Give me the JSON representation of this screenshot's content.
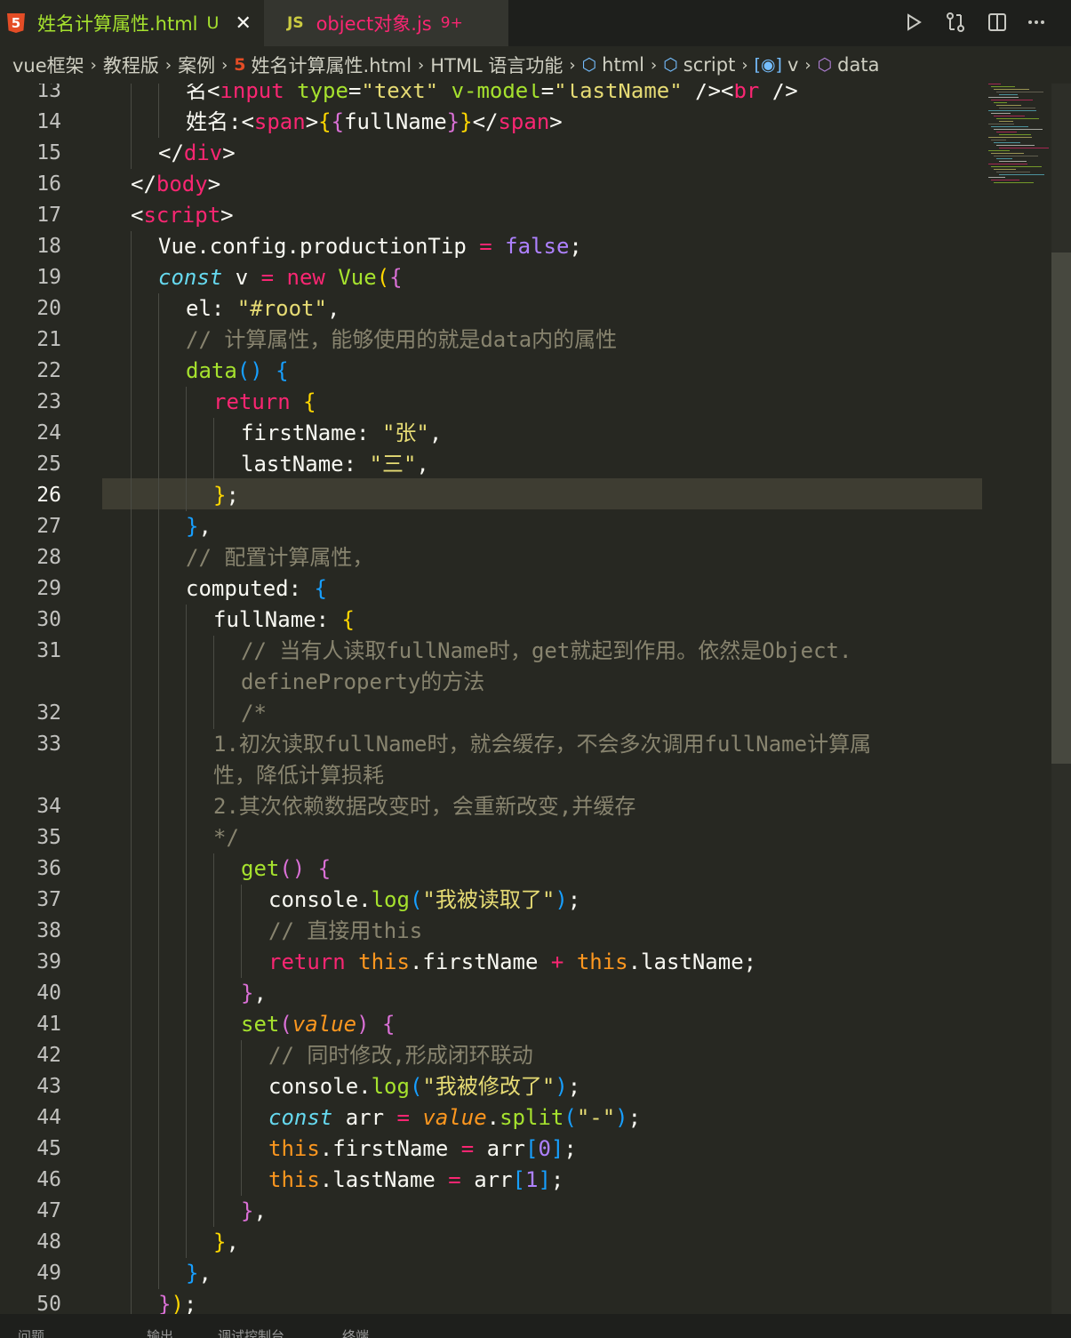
{
  "tabs": [
    {
      "label": "姓名计算属性.html",
      "modified": "U",
      "icon": "html5-icon"
    },
    {
      "label": "object对象.js",
      "modified": "9+",
      "icon": "js-icon"
    }
  ],
  "toolbar": {
    "run": "run-icon",
    "compare": "compare-changes-icon",
    "split": "split-editor-icon",
    "more": "more-actions-icon"
  },
  "breadcrumb": [
    {
      "label": "vue框架"
    },
    {
      "label": "教程版"
    },
    {
      "label": "案例"
    },
    {
      "label": "姓名计算属性.html",
      "icon": "html5-icon"
    },
    {
      "label": "HTML 语言功能"
    },
    {
      "label": "html",
      "icon": "cube-icon"
    },
    {
      "label": "script",
      "icon": "cube-icon"
    },
    {
      "label": "v",
      "icon": "variable-icon"
    },
    {
      "label": "data",
      "icon": "cube-icon"
    }
  ],
  "current_line": 26,
  "code": [
    {
      "n": "13",
      "indent": 2,
      "tokens": [
        [
          "",
          "名<"
        ],
        [
          "tok-tag",
          "input"
        ],
        [
          "",
          " "
        ],
        [
          "tok-attr",
          "type"
        ],
        [
          "",
          "="
        ],
        [
          "tok-str",
          "\"text\""
        ],
        [
          "",
          " "
        ],
        [
          "tok-attr",
          "v-model"
        ],
        [
          "",
          "="
        ],
        [
          "tok-str",
          "\"lastName\""
        ],
        [
          "",
          " /><"
        ],
        [
          "tok-tag",
          "br"
        ],
        [
          "",
          " />"
        ]
      ]
    },
    {
      "n": "14",
      "indent": 2,
      "tokens": [
        [
          "",
          "姓名:<"
        ],
        [
          "tok-tag",
          "span"
        ],
        [
          "",
          ">"
        ],
        [
          "tok-b1",
          "{"
        ],
        [
          "tok-b2",
          "{"
        ],
        [
          "",
          "fullName"
        ],
        [
          "tok-b2",
          "}"
        ],
        [
          "tok-b1",
          "}"
        ],
        [
          "",
          "</"
        ],
        [
          "tok-tag",
          "span"
        ],
        [
          "",
          ">"
        ]
      ]
    },
    {
      "n": "15",
      "indent": 1,
      "tokens": [
        [
          "",
          "</"
        ],
        [
          "tok-tag",
          "div"
        ],
        [
          "",
          ">"
        ]
      ]
    },
    {
      "n": "16",
      "indent": 0,
      "tokens": [
        [
          "",
          "</"
        ],
        [
          "tok-tag",
          "body"
        ],
        [
          "",
          ">"
        ]
      ]
    },
    {
      "n": "17",
      "indent": 0,
      "tokens": [
        [
          "",
          "<"
        ],
        [
          "tok-tag",
          "script"
        ],
        [
          "",
          ">"
        ]
      ]
    },
    {
      "n": "18",
      "indent": 1,
      "tokens": [
        [
          "",
          "Vue.config.productionTip "
        ],
        [
          "tok-op",
          "="
        ],
        [
          "",
          " "
        ],
        [
          "tok-const",
          "false"
        ],
        [
          "",
          ";"
        ]
      ]
    },
    {
      "n": "19",
      "indent": 1,
      "tokens": [
        [
          "tok-storage",
          "const"
        ],
        [
          "",
          " v "
        ],
        [
          "tok-op",
          "="
        ],
        [
          "",
          " "
        ],
        [
          "tok-kw",
          "new"
        ],
        [
          "",
          " "
        ],
        [
          "tok-func",
          "Vue"
        ],
        [
          "tok-b1",
          "("
        ],
        [
          "tok-b2",
          "{"
        ]
      ]
    },
    {
      "n": "20",
      "indent": 2,
      "tokens": [
        [
          "",
          "el: "
        ],
        [
          "tok-str",
          "\"#root\""
        ],
        [
          "",
          ","
        ]
      ]
    },
    {
      "n": "21",
      "indent": 2,
      "tokens": [
        [
          "tok-com",
          "// 计算属性，能够使用的就是data内的属性"
        ]
      ]
    },
    {
      "n": "22",
      "indent": 2,
      "tokens": [
        [
          "tok-func",
          "data"
        ],
        [
          "tok-b3",
          "()"
        ],
        [
          "",
          " "
        ],
        [
          "tok-b3",
          "{"
        ]
      ]
    },
    {
      "n": "23",
      "indent": 3,
      "tokens": [
        [
          "tok-kw",
          "return"
        ],
        [
          "",
          " "
        ],
        [
          "tok-b1",
          "{"
        ]
      ]
    },
    {
      "n": "24",
      "indent": 4,
      "tokens": [
        [
          "",
          "firstName: "
        ],
        [
          "tok-str",
          "\"张\""
        ],
        [
          "",
          ","
        ]
      ]
    },
    {
      "n": "25",
      "indent": 4,
      "tokens": [
        [
          "",
          "lastName: "
        ],
        [
          "tok-str",
          "\"三\""
        ],
        [
          "",
          ","
        ]
      ]
    },
    {
      "n": "26",
      "indent": 3,
      "tokens": [
        [
          "tok-b1",
          "}"
        ],
        [
          "",
          ";"
        ]
      ]
    },
    {
      "n": "27",
      "indent": 2,
      "tokens": [
        [
          "tok-b3",
          "}"
        ],
        [
          "",
          ","
        ]
      ]
    },
    {
      "n": "28",
      "indent": 2,
      "tokens": [
        [
          "tok-com",
          "// 配置计算属性，"
        ]
      ]
    },
    {
      "n": "29",
      "indent": 2,
      "tokens": [
        [
          "",
          "computed: "
        ],
        [
          "tok-b3",
          "{"
        ]
      ]
    },
    {
      "n": "30",
      "indent": 3,
      "tokens": [
        [
          "",
          "fullName: "
        ],
        [
          "tok-b1",
          "{"
        ]
      ]
    },
    {
      "n": "31",
      "indent": 4,
      "tokens": [
        [
          "tok-com",
          "// 当有人读取fullName时，get就起到作用。依然是Object."
        ]
      ]
    },
    {
      "n": "",
      "indent": 4,
      "tokens": [
        [
          "tok-com",
          "defineProperty的方法"
        ]
      ]
    },
    {
      "n": "32",
      "indent": 4,
      "tokens": [
        [
          "tok-com",
          "/*"
        ]
      ]
    },
    {
      "n": "33",
      "indent": 3,
      "tokens": [
        [
          "tok-com",
          "1.初次读取fullName时，就会缓存，不会多次调用fullName计算属"
        ]
      ]
    },
    {
      "n": "",
      "indent": 3,
      "tokens": [
        [
          "tok-com",
          "性，降低计算损耗"
        ]
      ]
    },
    {
      "n": "34",
      "indent": 3,
      "tokens": [
        [
          "tok-com",
          "2.其次依赖数据改变时，会重新改变,并缓存"
        ]
      ]
    },
    {
      "n": "35",
      "indent": 3,
      "tokens": [
        [
          "tok-com",
          "*/"
        ]
      ]
    },
    {
      "n": "36",
      "indent": 4,
      "tokens": [
        [
          "tok-func",
          "get"
        ],
        [
          "tok-b2",
          "()"
        ],
        [
          "",
          " "
        ],
        [
          "tok-b2",
          "{"
        ]
      ]
    },
    {
      "n": "37",
      "indent": 5,
      "tokens": [
        [
          "",
          "console."
        ],
        [
          "tok-func",
          "log"
        ],
        [
          "tok-b3",
          "("
        ],
        [
          "tok-str",
          "\"我被读取了\""
        ],
        [
          "tok-b3",
          ")"
        ],
        [
          "",
          ";"
        ]
      ]
    },
    {
      "n": "38",
      "indent": 5,
      "tokens": [
        [
          "tok-com",
          "// 直接用this"
        ]
      ]
    },
    {
      "n": "39",
      "indent": 5,
      "tokens": [
        [
          "tok-kw",
          "return"
        ],
        [
          "",
          " "
        ],
        [
          "tok-this",
          "this"
        ],
        [
          "",
          ".firstName "
        ],
        [
          "tok-op",
          "+"
        ],
        [
          "",
          " "
        ],
        [
          "tok-this",
          "this"
        ],
        [
          "",
          ".lastName;"
        ]
      ]
    },
    {
      "n": "40",
      "indent": 4,
      "tokens": [
        [
          "tok-b2",
          "}"
        ],
        [
          "",
          ","
        ]
      ]
    },
    {
      "n": "41",
      "indent": 4,
      "tokens": [
        [
          "tok-func",
          "set"
        ],
        [
          "tok-b2",
          "("
        ],
        [
          "tok-param",
          "value"
        ],
        [
          "tok-b2",
          ")"
        ],
        [
          "",
          " "
        ],
        [
          "tok-b2",
          "{"
        ]
      ]
    },
    {
      "n": "42",
      "indent": 5,
      "tokens": [
        [
          "tok-com",
          "// 同时修改,形成闭环联动"
        ]
      ]
    },
    {
      "n": "43",
      "indent": 5,
      "tokens": [
        [
          "",
          "console."
        ],
        [
          "tok-func",
          "log"
        ],
        [
          "tok-b3",
          "("
        ],
        [
          "tok-str",
          "\"我被修改了\""
        ],
        [
          "tok-b3",
          ")"
        ],
        [
          "",
          ";"
        ]
      ]
    },
    {
      "n": "44",
      "indent": 5,
      "tokens": [
        [
          "tok-storage",
          "const"
        ],
        [
          "",
          " arr "
        ],
        [
          "tok-op",
          "="
        ],
        [
          "",
          " "
        ],
        [
          "tok-param",
          "value"
        ],
        [
          "",
          "."
        ],
        [
          "tok-func",
          "split"
        ],
        [
          "tok-b3",
          "("
        ],
        [
          "tok-str",
          "\"-\""
        ],
        [
          "tok-b3",
          ")"
        ],
        [
          "",
          ";"
        ]
      ]
    },
    {
      "n": "45",
      "indent": 5,
      "tokens": [
        [
          "tok-this",
          "this"
        ],
        [
          "",
          ".firstName "
        ],
        [
          "tok-op",
          "="
        ],
        [
          "",
          " arr"
        ],
        [
          "tok-b3",
          "["
        ],
        [
          "tok-const",
          "0"
        ],
        [
          "tok-b3",
          "]"
        ],
        [
          "",
          ";"
        ]
      ]
    },
    {
      "n": "46",
      "indent": 5,
      "tokens": [
        [
          "tok-this",
          "this"
        ],
        [
          "",
          ".lastName "
        ],
        [
          "tok-op",
          "="
        ],
        [
          "",
          " arr"
        ],
        [
          "tok-b3",
          "["
        ],
        [
          "tok-const",
          "1"
        ],
        [
          "tok-b3",
          "]"
        ],
        [
          "",
          ";"
        ]
      ]
    },
    {
      "n": "47",
      "indent": 4,
      "tokens": [
        [
          "tok-b2",
          "}"
        ],
        [
          "",
          ","
        ]
      ]
    },
    {
      "n": "48",
      "indent": 3,
      "tokens": [
        [
          "tok-b1",
          "}"
        ],
        [
          "",
          ","
        ]
      ]
    },
    {
      "n": "49",
      "indent": 2,
      "tokens": [
        [
          "tok-b3",
          "}"
        ],
        [
          "",
          ","
        ]
      ]
    },
    {
      "n": "50",
      "indent": 1,
      "tokens": [
        [
          "tok-b2",
          "}"
        ],
        [
          "tok-b1",
          ")"
        ],
        [
          "",
          ";"
        ]
      ]
    }
  ],
  "statusbar": [
    "问题",
    "输出",
    "调试控制台",
    "终端"
  ]
}
